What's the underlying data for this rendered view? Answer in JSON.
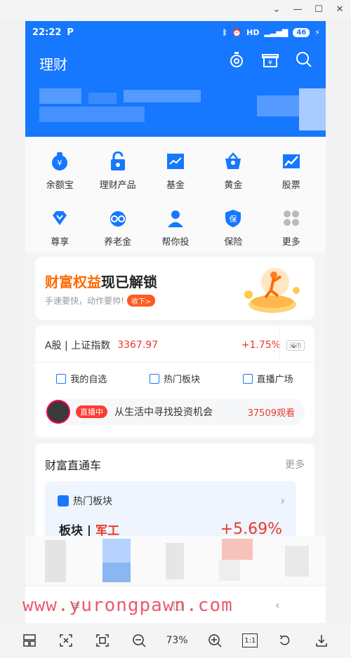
{
  "status": {
    "time": "22:22",
    "p_icon": "P",
    "battery": "46"
  },
  "header": {
    "title": "理财"
  },
  "grid": [
    {
      "label": "余额宝",
      "icon": "yuebao-icon"
    },
    {
      "label": "理财产品",
      "icon": "lock-icon"
    },
    {
      "label": "基金",
      "icon": "chart-icon"
    },
    {
      "label": "黄金",
      "icon": "basket-icon"
    },
    {
      "label": "股票",
      "icon": "stock-icon"
    },
    {
      "label": "尊享",
      "icon": "diamond-icon"
    },
    {
      "label": "养老金",
      "icon": "elder-icon"
    },
    {
      "label": "帮你投",
      "icon": "person-icon"
    },
    {
      "label": "保险",
      "icon": "shield-icon"
    },
    {
      "label": "更多",
      "icon": "more-icon"
    }
  ],
  "banner": {
    "title_hl": "财富权益",
    "title_rest": "现已解锁",
    "subtitle": "手速要快，动作要帅!",
    "button": "收下>"
  },
  "market": {
    "name": "A股 | 上证指数",
    "value": "3367.97",
    "change": "+1.75%",
    "tag": "闭市",
    "links": [
      "我的自选",
      "热门板块",
      "直播广场"
    ],
    "live_badge": "直播中",
    "live_title": "从生活中寻找投资机会",
    "live_count": "37509观看"
  },
  "wealth": {
    "title": "财富直通车",
    "more": "更多",
    "sub": "热门板块",
    "sector_prefix": "板块 | ",
    "sector_name": "军工",
    "pct": "+5.69%"
  },
  "watermark": "www.yurongpawn.com",
  "toolbar": {
    "zoom": "73%",
    "one_to_one": "1:1"
  },
  "colors": {
    "brand_blue": "#1677ff",
    "up_red": "#e8392e",
    "orange": "#ff6a00"
  }
}
